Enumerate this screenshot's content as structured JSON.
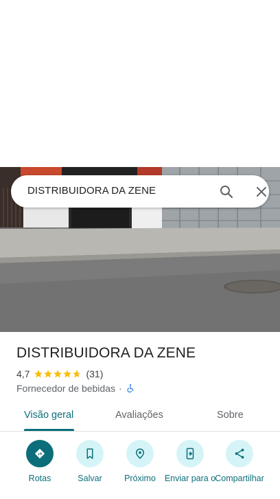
{
  "search": {
    "query": "DISTRIBUIDORA DA ZENE"
  },
  "place": {
    "title": "DISTRIBUIDORA DA ZENE",
    "rating": "4,7",
    "rating_stars": 4.7,
    "review_count": "(31)",
    "category": "Fornecedor de bebidas",
    "separator": "·"
  },
  "tabs": [
    {
      "label": "Visão geral",
      "active": true
    },
    {
      "label": "Avaliações",
      "active": false
    },
    {
      "label": "Sobre",
      "active": false
    }
  ],
  "actions": [
    {
      "label": "Rotas",
      "icon": "directions-icon"
    },
    {
      "label": "Salvar",
      "icon": "bookmark-icon"
    },
    {
      "label": "Próximo",
      "icon": "nearby-icon"
    },
    {
      "label": "Enviar para o",
      "icon": "send-to-phone-icon"
    },
    {
      "label": "Compartilhar",
      "icon": "share-icon"
    }
  ],
  "colors": {
    "accent": "#0b6e7a",
    "accent_light": "#d5f4f7",
    "star": "#fbbc04"
  }
}
